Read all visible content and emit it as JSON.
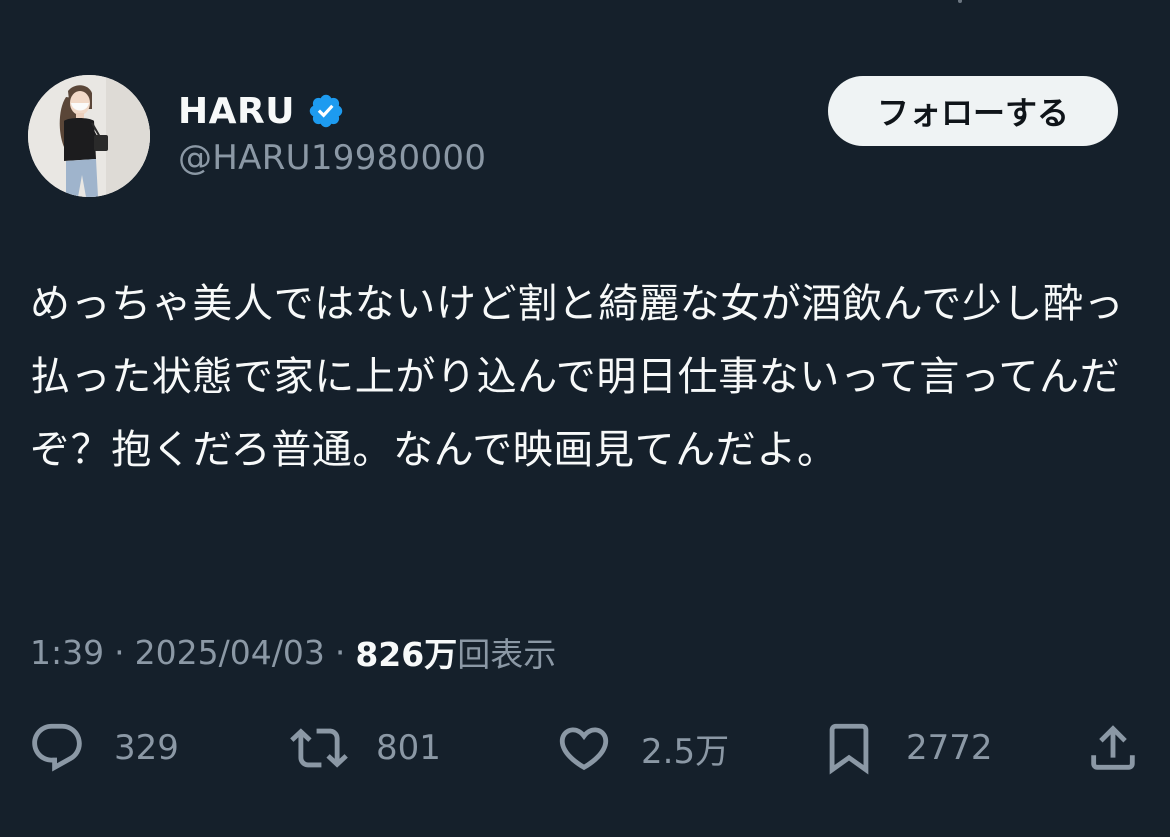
{
  "author": {
    "display_name": "HARU",
    "handle": "@HARU19980000",
    "verified_icon": "verified-badge-icon",
    "avatar_icon": "profile-photo"
  },
  "follow_button": {
    "label": "フォローする"
  },
  "post": {
    "text": "めっちゃ美人ではないけど割と綺麗な女が酒飲んで少し酔っ払った状態で家に上がり込んで明日仕事ないって言ってんだぞ？抱くだろ普通。なんで映画見てんだよ。"
  },
  "meta": {
    "time": "1:39",
    "separator": "·",
    "date": "2025/04/03",
    "views_count": "826万",
    "views_label": "回表示"
  },
  "actions": {
    "reply": {
      "icon": "reply-icon",
      "count": "329"
    },
    "repost": {
      "icon": "repost-icon",
      "count": "801"
    },
    "like": {
      "icon": "heart-icon",
      "count": "2.5万"
    },
    "bookmark": {
      "icon": "bookmark-icon",
      "count": "2772"
    },
    "share": {
      "icon": "share-icon"
    }
  },
  "colors": {
    "background": "#15202b",
    "primary_text": "#f7f9f9",
    "secondary_text": "#8b98a5",
    "verified_blue": "#1d9bf0",
    "follow_button_bg": "#eff3f4"
  }
}
